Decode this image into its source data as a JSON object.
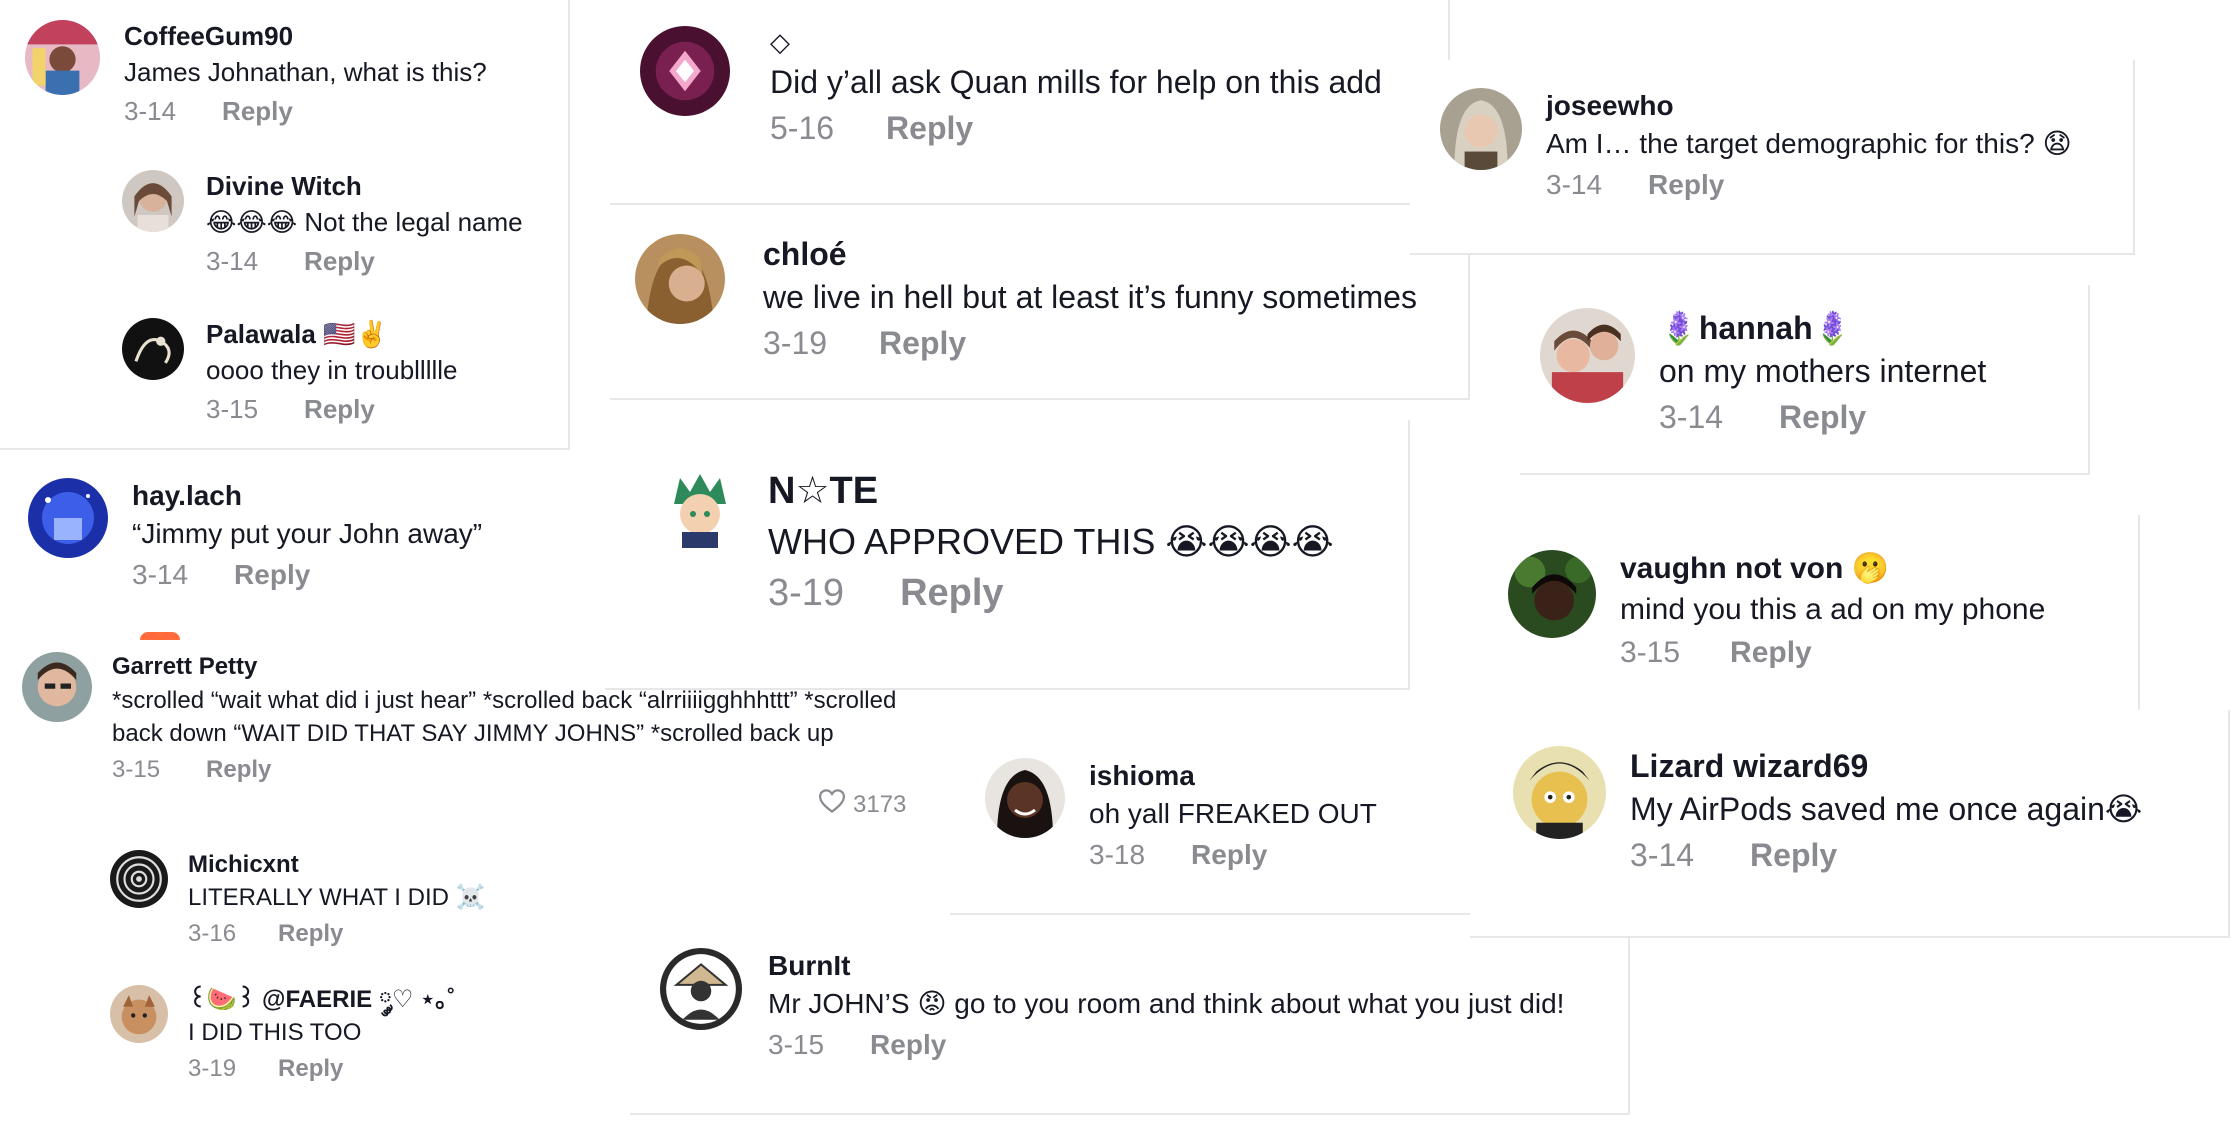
{
  "comments": {
    "coffeegum90": {
      "name": "CoffeeGum90",
      "text": "James Johnathan, what is this?",
      "date": "3-14",
      "reply": "Reply"
    },
    "divine_witch": {
      "name": "Divine Witch",
      "text": "😂😂😂 Not the legal name",
      "date": "3-14",
      "reply": "Reply"
    },
    "palawala": {
      "name": "Palawala 🇺🇸✌️",
      "text": "oooo they in troubllllle",
      "date": "3-15",
      "reply": "Reply"
    },
    "hay_lach": {
      "name": "hay.lach",
      "text": "“Jimmy put your John away”",
      "date": "3-14",
      "reply": "Reply"
    },
    "garrett": {
      "name": "Garrett Petty",
      "text": "*scrolled “wait what did i just hear” *scrolled back “alrriiiigghhhttt” *scrolled back down “WAIT DID THAT SAY JIMMY JOHNS” *scrolled back up",
      "date": "3-15",
      "reply": "Reply",
      "likes": "3173"
    },
    "michicxnt": {
      "name": "Michicxnt",
      "text": "LITERALLY WHAT I DID ☠️",
      "date": "3-16",
      "reply": "Reply"
    },
    "faerie": {
      "name": "꒰🍉꒱ @FAERIE ༘♡ ⋆｡˚",
      "text": "I DID THIS TOO",
      "date": "3-19",
      "reply": "Reply"
    },
    "diamond": {
      "name": "◇",
      "text": "Did y’all ask Quan mills for help on this add",
      "date": "5-16",
      "reply": "Reply"
    },
    "chloe": {
      "name": "chloé",
      "text": "we live in hell but at least it’s funny sometimes",
      "date": "3-19",
      "reply": "Reply"
    },
    "nate": {
      "name": "N☆TE",
      "text": "WHO APPROVED THIS 😭😭😭😭",
      "date": "3-19",
      "reply": "Reply"
    },
    "ishioma": {
      "name": "ishioma",
      "text": "oh yall FREAKED OUT",
      "date": "3-18",
      "reply": "Reply"
    },
    "burnit": {
      "name": "BurnIt",
      "text": "Mr JOHN’S 😡 go to you room and think about what you just did!",
      "date": "3-15",
      "reply": "Reply"
    },
    "joseewho": {
      "name": "joseewho",
      "text": "Am I… the target demographic for this? 😧",
      "date": "3-14",
      "reply": "Reply"
    },
    "hannah": {
      "name": "🪻hannah🪻",
      "text": "on my mothers internet",
      "date": "3-14",
      "reply": "Reply"
    },
    "vaughn": {
      "name": "vaughn not von 🫢",
      "text": "mind you this a ad on my phone",
      "date": "3-15",
      "reply": "Reply"
    },
    "lizard": {
      "name": "Lizard wizard69",
      "text": "My AirPods saved me once again😭",
      "date": "3-14",
      "reply": "Reply"
    }
  },
  "icons": {
    "like": "heart-outline-icon"
  },
  "colors": {
    "text": "#161823",
    "muted": "#8a8b91"
  }
}
